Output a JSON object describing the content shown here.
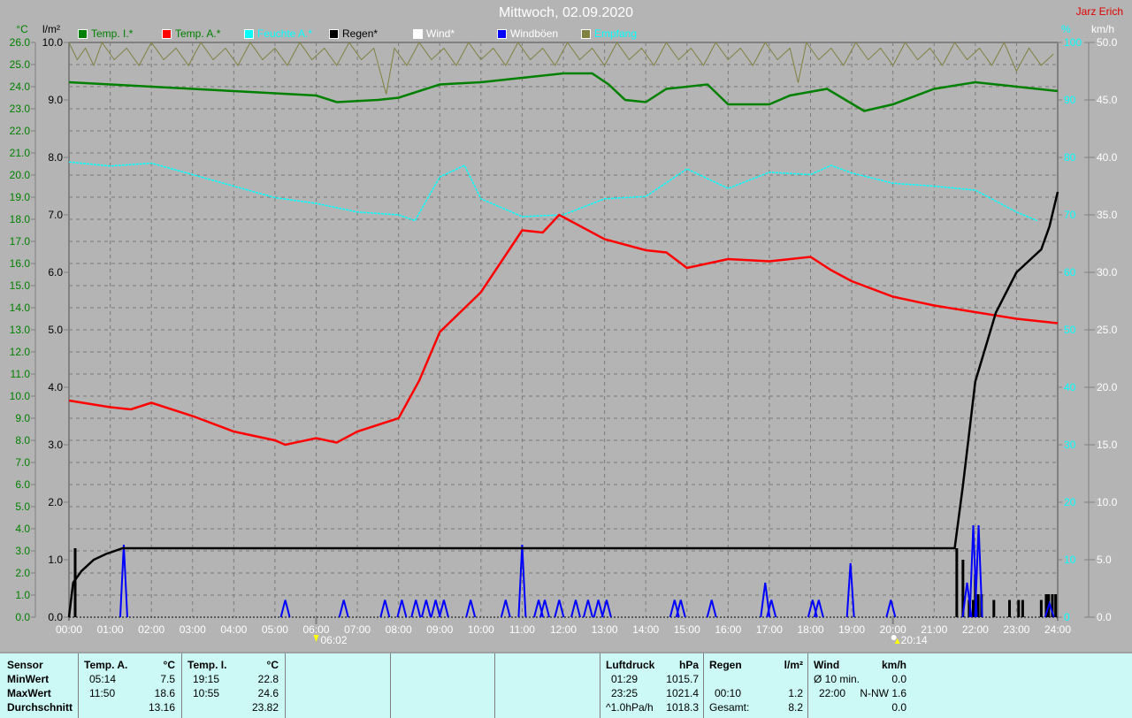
{
  "header": {
    "title": "Mittwoch, 02.09.2020",
    "owner": "Jarz Erich"
  },
  "legend": [
    {
      "label": "Temp. I.*",
      "color": "#008000",
      "text_color": "#008000"
    },
    {
      "label": "Temp. A.*",
      "color": "#ff0000",
      "text_color": "#008000"
    },
    {
      "label": "Feuchte A.*",
      "color": "#00ffff",
      "text_color": "#00ffff"
    },
    {
      "label": "Regen*",
      "color": "#000000",
      "text_color": "#000000"
    },
    {
      "label": "Wind*",
      "color": "#ffffff",
      "text_color": "#ffffff"
    },
    {
      "label": "Windböen",
      "color": "#0000ff",
      "text_color": "#ffffff"
    },
    {
      "label": "Empfang",
      "color": "#808040",
      "text_color": "#00ffff"
    }
  ],
  "axes": {
    "temp_unit": "°C",
    "rain_unit": "l/m²",
    "hum_unit": "%",
    "wind_unit": "km/h",
    "temp_ticks": [
      "0.0",
      "1.0",
      "2.0",
      "3.0",
      "4.0",
      "5.0",
      "6.0",
      "7.0",
      "8.0",
      "9.0",
      "10.0",
      "11.0",
      "12.0",
      "13.0",
      "14.0",
      "15.0",
      "16.0",
      "17.0",
      "18.0",
      "19.0",
      "20.0",
      "21.0",
      "22.0",
      "23.0",
      "24.0",
      "25.0",
      "26.0"
    ],
    "rain_ticks": [
      "0.0",
      "1.0",
      "2.0",
      "3.0",
      "4.0",
      "5.0",
      "6.0",
      "7.0",
      "8.0",
      "9.0",
      "10.0"
    ],
    "hum_ticks": [
      "0",
      "10",
      "20",
      "30",
      "40",
      "50",
      "60",
      "70",
      "80",
      "90",
      "100"
    ],
    "wind_ticks": [
      "0.0",
      "5.0",
      "10.0",
      "15.0",
      "20.0",
      "25.0",
      "30.0",
      "35.0",
      "40.0",
      "45.0",
      "50.0"
    ],
    "x_ticks": [
      "00:00",
      "01:00",
      "02:00",
      "03:00",
      "04:00",
      "05:00",
      "06:00",
      "07:00",
      "08:00",
      "09:00",
      "10:00",
      "11:00",
      "12:00",
      "13:00",
      "14:00",
      "15:00",
      "16:00",
      "17:00",
      "18:00",
      "19:00",
      "20:00",
      "21:00",
      "22:00",
      "23:00",
      "24:00"
    ],
    "sunrise": "06:02",
    "sunset": "20:14"
  },
  "chart_data": {
    "type": "line",
    "title": "Mittwoch, 02.09.2020",
    "xlabel": "",
    "xlim": [
      0,
      24
    ],
    "ylim_temp": [
      0,
      26
    ],
    "ylim_rain": [
      0,
      10
    ],
    "ylim_hum": [
      0,
      100
    ],
    "ylim_wind": [
      0,
      50
    ],
    "grid": true,
    "legend_position": "top",
    "series": [
      {
        "name": "Temp. I.*",
        "axis": "temp",
        "color": "#008000",
        "points": [
          [
            0,
            24.2
          ],
          [
            1,
            24.1
          ],
          [
            2,
            24.0
          ],
          [
            3,
            23.9
          ],
          [
            4,
            23.8
          ],
          [
            5,
            23.7
          ],
          [
            6,
            23.6
          ],
          [
            6.5,
            23.3
          ],
          [
            7.5,
            23.4
          ],
          [
            8,
            23.5
          ],
          [
            9,
            24.1
          ],
          [
            10,
            24.2
          ],
          [
            11,
            24.4
          ],
          [
            12,
            24.6
          ],
          [
            12.7,
            24.6
          ],
          [
            13.1,
            24.1
          ],
          [
            13.5,
            23.4
          ],
          [
            14,
            23.3
          ],
          [
            14.5,
            23.9
          ],
          [
            15.5,
            24.1
          ],
          [
            16,
            23.2
          ],
          [
            17,
            23.2
          ],
          [
            17.5,
            23.6
          ],
          [
            18.4,
            23.9
          ],
          [
            19.3,
            22.9
          ],
          [
            20,
            23.2
          ],
          [
            21,
            23.9
          ],
          [
            22,
            24.2
          ],
          [
            23,
            24.0
          ],
          [
            24,
            23.8
          ]
        ]
      },
      {
        "name": "Temp. A.*",
        "axis": "temp",
        "color": "#ff0000",
        "points": [
          [
            0,
            9.8
          ],
          [
            1,
            9.5
          ],
          [
            1.5,
            9.4
          ],
          [
            2,
            9.7
          ],
          [
            3,
            9.1
          ],
          [
            4,
            8.4
          ],
          [
            5,
            8.0
          ],
          [
            5.25,
            7.8
          ],
          [
            6,
            8.1
          ],
          [
            6.5,
            7.9
          ],
          [
            7,
            8.4
          ],
          [
            8,
            9.0
          ],
          [
            8.5,
            10.7
          ],
          [
            9,
            12.9
          ],
          [
            10,
            14.7
          ],
          [
            11,
            17.5
          ],
          [
            11.5,
            17.4
          ],
          [
            11.9,
            18.2
          ],
          [
            13,
            17.1
          ],
          [
            14,
            16.6
          ],
          [
            14.5,
            16.5
          ],
          [
            15,
            15.8
          ],
          [
            16,
            16.2
          ],
          [
            17,
            16.1
          ],
          [
            18,
            16.3
          ],
          [
            18.5,
            15.7
          ],
          [
            19,
            15.2
          ],
          [
            20,
            14.5
          ],
          [
            21,
            14.1
          ],
          [
            22,
            13.8
          ],
          [
            23,
            13.5
          ],
          [
            24,
            13.3
          ]
        ]
      },
      {
        "name": "Feuchte A.*",
        "axis": "hum",
        "color": "#00ffff",
        "points": [
          [
            0,
            79.2
          ],
          [
            1,
            78.5
          ],
          [
            2,
            79.0
          ],
          [
            3,
            77.0
          ],
          [
            4,
            75.0
          ],
          [
            5,
            73.0
          ],
          [
            6,
            72.0
          ],
          [
            7,
            70.5
          ],
          [
            8,
            70.0
          ],
          [
            8.4,
            69.0
          ],
          [
            9,
            76.6
          ],
          [
            9.6,
            78.6
          ],
          [
            10,
            72.8
          ],
          [
            11,
            69.7
          ],
          [
            12,
            70.0
          ],
          [
            13,
            72.8
          ],
          [
            14,
            73.2
          ],
          [
            15,
            78.0
          ],
          [
            16,
            74.6
          ],
          [
            17,
            77.4
          ],
          [
            18,
            77.0
          ],
          [
            18.5,
            78.6
          ],
          [
            19,
            77.3
          ],
          [
            20,
            75.5
          ],
          [
            21,
            75.0
          ],
          [
            22,
            74.3
          ],
          [
            23,
            70.5
          ],
          [
            23.5,
            69.0
          ]
        ]
      },
      {
        "name": "Regen*",
        "axis": "rain",
        "color": "#000000",
        "points": [
          [
            0,
            0
          ],
          [
            0.1,
            0.6
          ],
          [
            0.3,
            0.8
          ],
          [
            0.6,
            1.0
          ],
          [
            0.9,
            1.1
          ],
          [
            1.3,
            1.2
          ],
          [
            21.5,
            1.2
          ],
          [
            21.7,
            2.3
          ],
          [
            22,
            4.1
          ],
          [
            22.5,
            5.3
          ],
          [
            23,
            6.0
          ],
          [
            23.3,
            6.2
          ],
          [
            23.6,
            6.4
          ],
          [
            23.8,
            6.8
          ],
          [
            24,
            7.4
          ]
        ]
      },
      {
        "name": "Empfang",
        "axis": "hum",
        "color": "#808040",
        "points": [
          [
            0,
            100
          ],
          [
            0.2,
            97
          ],
          [
            0.4,
            99
          ],
          [
            0.6,
            96
          ],
          [
            0.8,
            100
          ],
          [
            1.1,
            97
          ],
          [
            1.4,
            99
          ],
          [
            1.7,
            96
          ],
          [
            2,
            100
          ],
          [
            2.3,
            97
          ],
          [
            2.6,
            99
          ],
          [
            2.9,
            96
          ],
          [
            3.2,
            100
          ],
          [
            3.5,
            97
          ],
          [
            3.8,
            99
          ],
          [
            4.1,
            96
          ],
          [
            4.4,
            100
          ],
          [
            4.7,
            97
          ],
          [
            5,
            99
          ],
          [
            5.3,
            96
          ],
          [
            5.6,
            100
          ],
          [
            5.9,
            97
          ],
          [
            6.2,
            99
          ],
          [
            6.5,
            96
          ],
          [
            6.8,
            100
          ],
          [
            7.1,
            97
          ],
          [
            7.4,
            99
          ],
          [
            7.7,
            91
          ],
          [
            7.9,
            99
          ],
          [
            8.2,
            96
          ],
          [
            8.5,
            100
          ],
          [
            8.8,
            97
          ],
          [
            9.1,
            99
          ],
          [
            9.4,
            96
          ],
          [
            9.7,
            100
          ],
          [
            10,
            97
          ],
          [
            10.3,
            99
          ],
          [
            10.6,
            96
          ],
          [
            10.9,
            100
          ],
          [
            11.2,
            97
          ],
          [
            11.5,
            99
          ],
          [
            11.8,
            96
          ],
          [
            12.1,
            100
          ],
          [
            12.4,
            97
          ],
          [
            12.7,
            99
          ],
          [
            13,
            96
          ],
          [
            13.3,
            100
          ],
          [
            13.6,
            97
          ],
          [
            13.9,
            99
          ],
          [
            14.2,
            96
          ],
          [
            14.5,
            100
          ],
          [
            14.8,
            97
          ],
          [
            15.1,
            99
          ],
          [
            15.4,
            96
          ],
          [
            15.7,
            100
          ],
          [
            16,
            97
          ],
          [
            16.3,
            99
          ],
          [
            16.6,
            96
          ],
          [
            16.9,
            100
          ],
          [
            17.2,
            97
          ],
          [
            17.5,
            99
          ],
          [
            17.7,
            93
          ],
          [
            17.9,
            100
          ],
          [
            18.2,
            97
          ],
          [
            18.5,
            99
          ],
          [
            18.8,
            96
          ],
          [
            19.1,
            100
          ],
          [
            19.4,
            97
          ],
          [
            19.7,
            99
          ],
          [
            20,
            96
          ],
          [
            20.3,
            100
          ],
          [
            20.6,
            97
          ],
          [
            20.9,
            99
          ],
          [
            21.2,
            96
          ],
          [
            21.5,
            100
          ],
          [
            21.8,
            97
          ],
          [
            22.1,
            99
          ],
          [
            22.4,
            96
          ],
          [
            22.7,
            100
          ],
          [
            23,
            95
          ],
          [
            23.3,
            99
          ],
          [
            23.6,
            96
          ],
          [
            23.9,
            98
          ]
        ]
      }
    ],
    "wind_gusts_kmh": [
      [
        1.33,
        6.3
      ],
      [
        5.25,
        1.5
      ],
      [
        6.67,
        1.5
      ],
      [
        7.67,
        1.5
      ],
      [
        8.08,
        1.5
      ],
      [
        8.42,
        1.5
      ],
      [
        8.67,
        1.5
      ],
      [
        8.9,
        1.5
      ],
      [
        9.1,
        1.5
      ],
      [
        9.75,
        1.5
      ],
      [
        10.6,
        1.5
      ],
      [
        11.0,
        6.3
      ],
      [
        11.4,
        1.5
      ],
      [
        11.55,
        1.5
      ],
      [
        11.9,
        1.5
      ],
      [
        12.3,
        1.5
      ],
      [
        12.6,
        1.5
      ],
      [
        12.85,
        1.5
      ],
      [
        13.05,
        1.5
      ],
      [
        14.7,
        1.5
      ],
      [
        14.85,
        1.5
      ],
      [
        15.6,
        1.5
      ],
      [
        16.9,
        3.0
      ],
      [
        17.05,
        1.5
      ],
      [
        18.05,
        1.5
      ],
      [
        18.2,
        1.5
      ],
      [
        18.97,
        4.7
      ],
      [
        19.95,
        1.5
      ],
      [
        21.8,
        3.0
      ],
      [
        21.95,
        8.0
      ],
      [
        22.08,
        8.0
      ],
      [
        23.8,
        1.2
      ]
    ],
    "rain_bars_l": [
      [
        0.15,
        1.2
      ],
      [
        21.55,
        1.2
      ],
      [
        21.7,
        1.0
      ],
      [
        21.85,
        0.3
      ],
      [
        21.95,
        0.3
      ],
      [
        22.0,
        0.75
      ],
      [
        22.07,
        0.4
      ],
      [
        22.15,
        0.4
      ],
      [
        22.45,
        0.3
      ],
      [
        22.83,
        0.3
      ],
      [
        23.05,
        0.3
      ],
      [
        23.15,
        0.3
      ],
      [
        23.6,
        0.3
      ],
      [
        23.72,
        0.4
      ],
      [
        23.78,
        0.4
      ],
      [
        23.87,
        0.4
      ],
      [
        23.95,
        0.4
      ]
    ]
  },
  "table": {
    "sensor": {
      "header": "Sensor",
      "rows": [
        "MinWert",
        "MaxWert",
        "Durchschnitt"
      ]
    },
    "temp_a": {
      "header": "Temp. A.",
      "unit": "°C",
      "min_time": "05:14",
      "min": "7.5",
      "max_time": "11:50",
      "max": "18.6",
      "avg": "13.16"
    },
    "temp_i": {
      "header": "Temp. I.",
      "unit": "°C",
      "min_time": "19:15",
      "min": "22.8",
      "max_time": "10:55",
      "max": "24.6",
      "avg": "23.82"
    },
    "pressure": {
      "header": "Luftdruck",
      "unit": "hPa",
      "min_time": "01:29",
      "min": "1015.7",
      "max_time": "23:25",
      "max": "1021.4",
      "trend": "^1.0hPa/h",
      "avg": "1018.3"
    },
    "rain": {
      "header": "Regen",
      "unit": "l/m²",
      "max_time": "00:10",
      "max": "1.2",
      "total_label": "Gesamt:",
      "total": "8.2"
    },
    "wind": {
      "header": "Wind",
      "unit": "km/h",
      "avg_label": "Ø 10 min.",
      "avg": "0.0",
      "max_time": "22:00",
      "max": "N-NW 1.6",
      "last": "0.0"
    }
  }
}
